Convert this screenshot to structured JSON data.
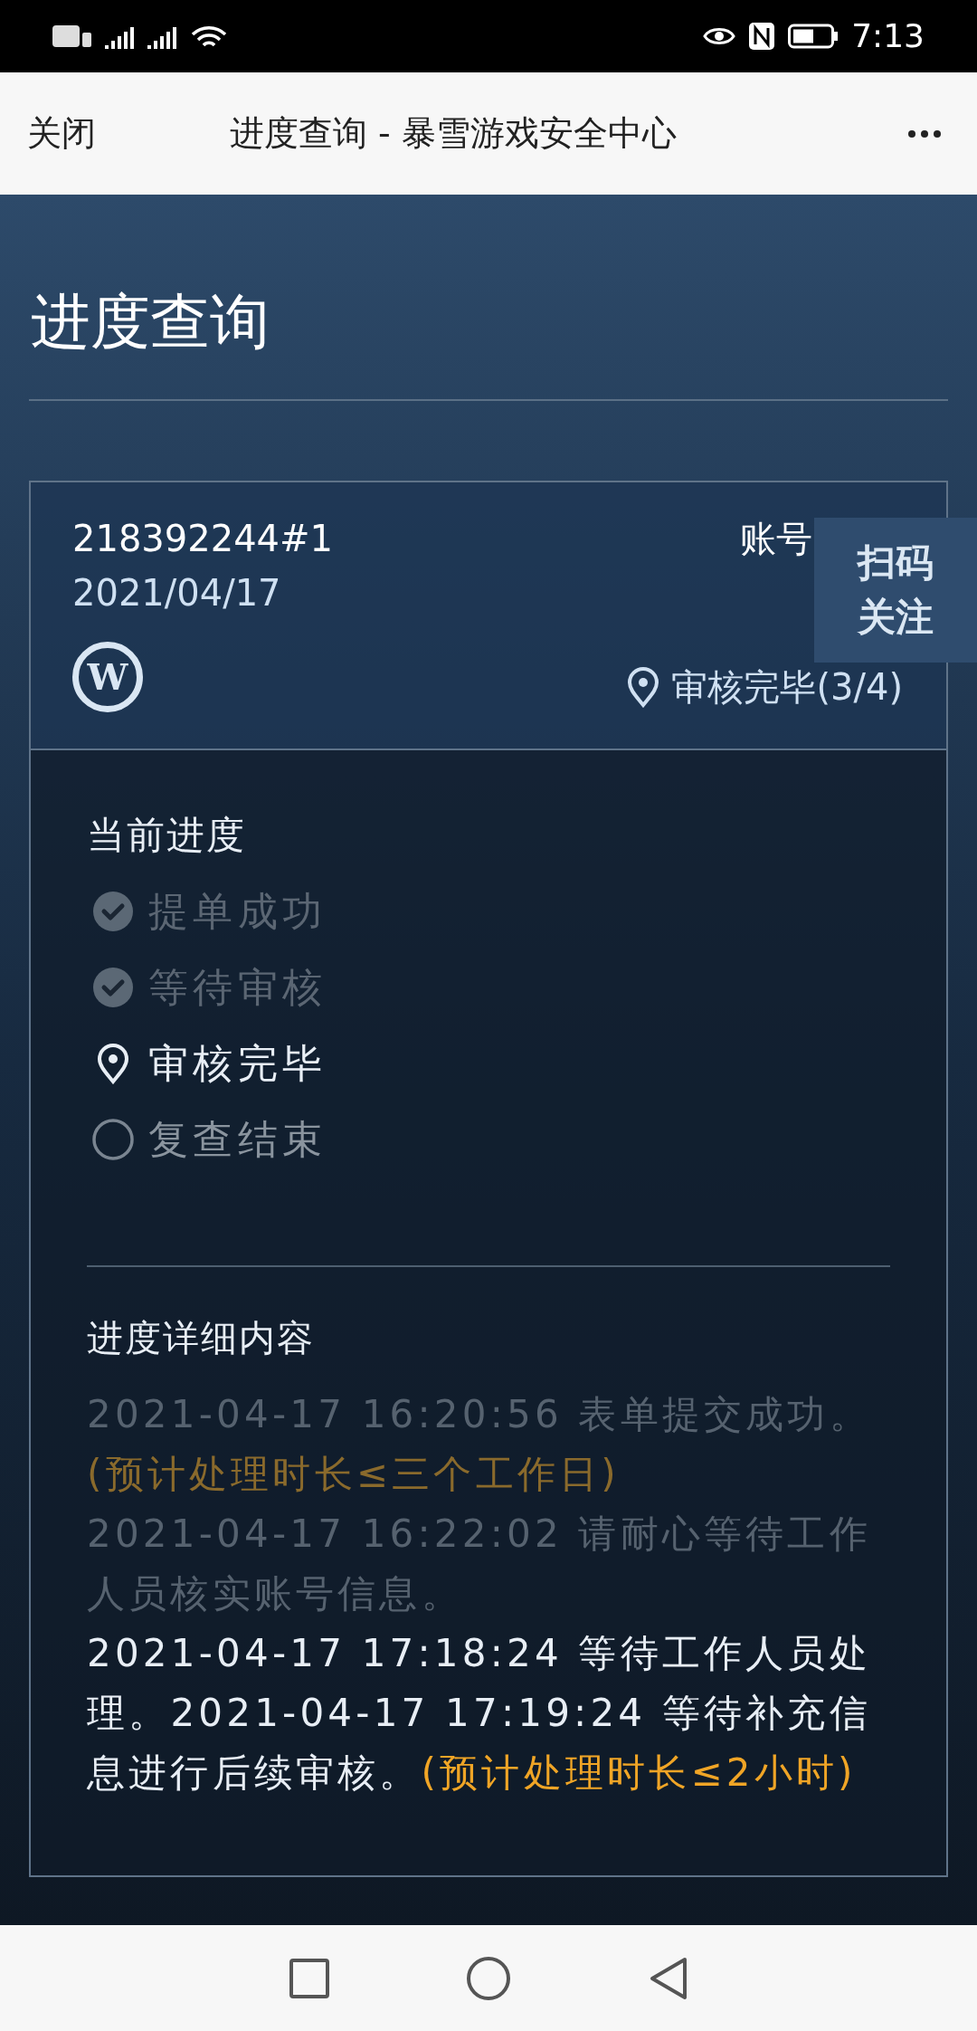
{
  "status_bar": {
    "time": "7:13"
  },
  "nav": {
    "close": "关闭",
    "title": "进度查询 - 暴雪游戏安全中心"
  },
  "page_title": "进度查询",
  "ticket": {
    "id": "218392244#1",
    "date": "2021/04/17",
    "logo_text": "W",
    "account_label": "账号",
    "status": "审核完毕(3/4)"
  },
  "follow_button": {
    "lines": [
      "扫码",
      "关注"
    ]
  },
  "progress": {
    "heading": "当前进度",
    "steps": [
      {
        "label": "提单成功",
        "kind": "done"
      },
      {
        "label": "等待审核",
        "kind": "done"
      },
      {
        "label": "审核完毕",
        "kind": "current"
      },
      {
        "label": "复查结束",
        "kind": "pending"
      }
    ]
  },
  "details": {
    "heading": "进度详细内容",
    "paragraphs": [
      {
        "segments": [
          {
            "text": "2021-04-17 16:20:56 表单提交成功。",
            "kind": "muted"
          },
          {
            "text": "(预计处理时长≤三个工作日)",
            "kind": "note_muted"
          }
        ]
      },
      {
        "segments": [
          {
            "text": "2021-04-17 16:22:02 请耐心等待工作人员核实账号信息。",
            "kind": "muted"
          }
        ]
      },
      {
        "segments": [
          {
            "text": "2021-04-17 17:18:24 等待工作人员处理。2021-04-17 17:19:24 等待补充信息进行后续审核。",
            "kind": "normal"
          },
          {
            "text": "(预计处理时长≤2小时)",
            "kind": "note"
          }
        ]
      }
    ]
  }
}
